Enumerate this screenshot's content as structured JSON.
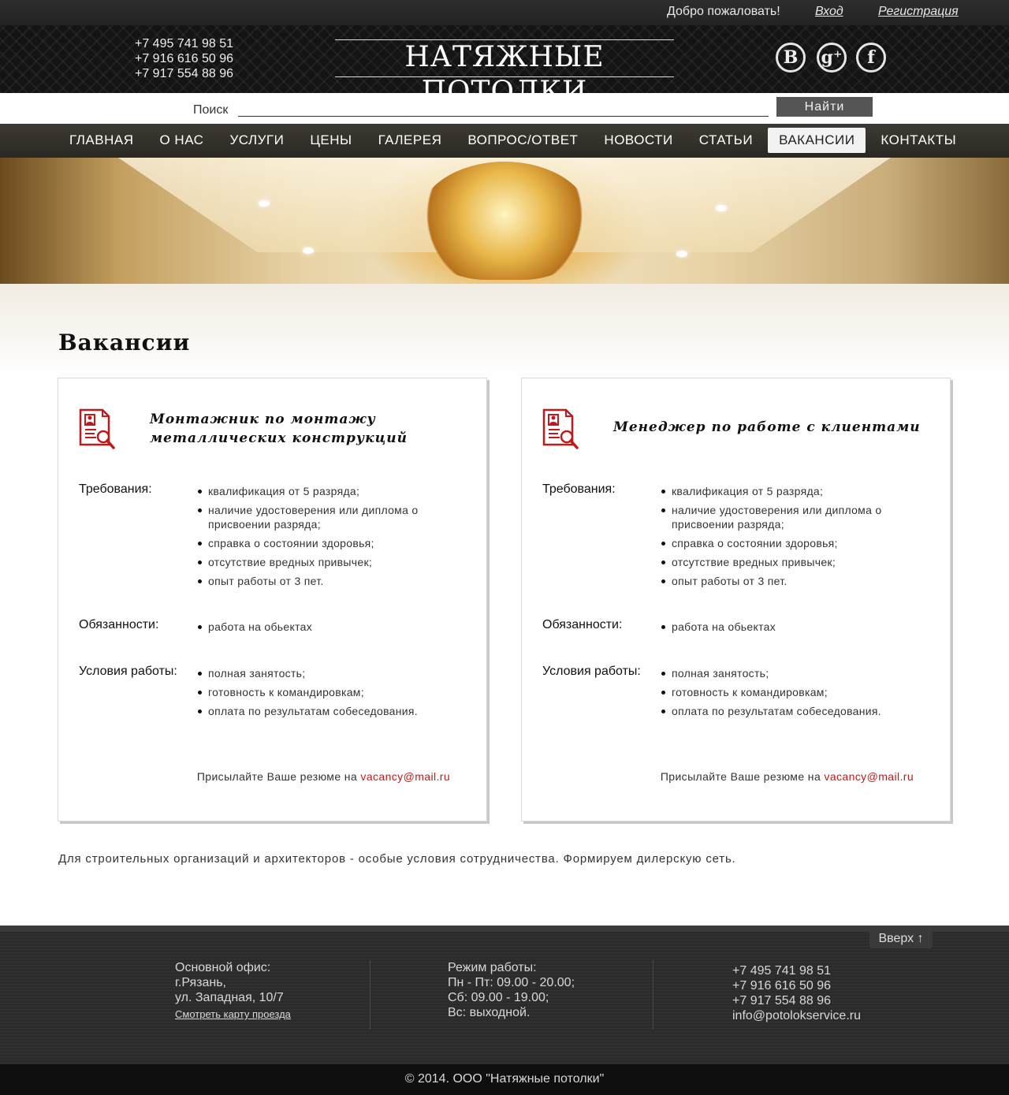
{
  "topbar": {
    "welcome": "Добро пожаловать!",
    "login": "Вход",
    "register": "Регистрация"
  },
  "header": {
    "phones": [
      "+7 495 741 98 51",
      "+7 916 616 50 96",
      "+7 917 554 88 96"
    ],
    "logo": "НАТЯЖНЫЕ ПОТОЛКИ",
    "social": [
      {
        "icon": "vk-icon",
        "glyph": "В"
      },
      {
        "icon": "google-plus-icon",
        "glyph": "g⁺"
      },
      {
        "icon": "facebook-icon",
        "glyph": "f"
      }
    ]
  },
  "search": {
    "label": "Поиск",
    "value": "",
    "button": "Найти"
  },
  "nav": {
    "items": [
      "ГЛАВНАЯ",
      "О НАС",
      "УСЛУГИ",
      "ЦЕНЫ",
      "ГАЛЕРЕЯ",
      "ВОПРОС/ОТВЕТ",
      "НОВОСТИ",
      "СТАТЬИ",
      "ВАКАНСИИ",
      "КОНТАКТЫ"
    ],
    "active": "ВАКАНСИИ"
  },
  "page": {
    "title": "Вакансии"
  },
  "vacancies": [
    {
      "title": "Монтажник по монтажу металлических конструкций",
      "requirements_label": "Требования:",
      "requirements": [
        "квалификация от 5 разряда;",
        "наличие удостоверения или диплома о присвоении разряда;",
        "справка о состоянии здоровья;",
        "отсутствие вредных привычек;",
        "опыт работы от 3 пет."
      ],
      "duties_label": "Обязанности:",
      "duties": [
        "работа на обьектах"
      ],
      "conditions_label": "Условия работы:",
      "conditions": [
        "полная занятость;",
        "готовность к командировкам;",
        "оплата по результатам собеседования."
      ],
      "resume_text": "Присылайте Ваше резюме на ",
      "email": "vacancy@mail.ru"
    },
    {
      "title": "Менеджер по работе с клиентами",
      "requirements_label": "Требования:",
      "requirements": [
        "квалификация от 5 разряда;",
        "наличие удостоверения или диплома о присвоении разряда;",
        "справка о состоянии здоровья;",
        "отсутствие вредных привычек;",
        "опыт работы от 3 пет."
      ],
      "duties_label": "Обязанности:",
      "duties": [
        "работа на обьектах"
      ],
      "conditions_label": "Условия работы:",
      "conditions": [
        "полная занятость;",
        "готовность к командировкам;",
        "оплата по результатам собеседования."
      ],
      "resume_text": "Присылайте Ваше резюме на ",
      "email": "vacancy@mail.ru"
    }
  ],
  "note": "Для строительных организаций и архитекторов - особые условия сотрудничества.  Формируем дилерскую сеть.",
  "footer": {
    "up": "Вверх",
    "office": [
      "Основной офис:",
      "г.Рязань,",
      "ул. Западная, 10/7"
    ],
    "map_link": "Смотреть карту проезда",
    "hours": [
      "Режим работы:",
      "Пн - Пт: 09.00 - 20.00;",
      "Сб: 09.00 - 19.00;",
      "Вс: выходной."
    ],
    "contacts": [
      "+7 495 741 98 51",
      "+7 916 616 50 96",
      "+7 917 554 88 96",
      "info@potolokservice.ru"
    ],
    "copyright": "© 2014. ООО \"Натяжные потолки\""
  },
  "colors": {
    "accent": "#c01a1a",
    "dark": "#2b2b2b",
    "nav_active_bg": "#f2f2f2"
  }
}
